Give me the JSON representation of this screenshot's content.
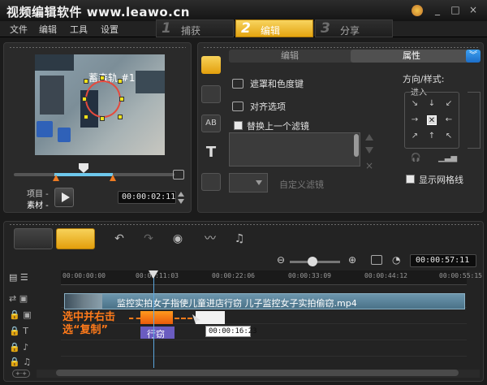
{
  "app": {
    "title": "视频编辑软件 www.leawo.cn"
  },
  "menu": {
    "items": [
      "文件",
      "编辑",
      "工具",
      "设置"
    ]
  },
  "steps": [
    {
      "num": "1",
      "label": "捕获"
    },
    {
      "num": "2",
      "label": "编辑"
    },
    {
      "num": "3",
      "label": "分享"
    }
  ],
  "player": {
    "overlay_text": "蓄森轨 #1",
    "project_label": "项目 -",
    "clip_label": "素材 -",
    "timecode": "00:00:02:11"
  },
  "props": {
    "tab_edit": "编辑",
    "tab_attr": "属性",
    "mask_label": "遮罩和色度键",
    "align_label": "对齐选项",
    "replace_filter_label": "替换上一个滤镜",
    "custom_filter_label": "自定义滤镜",
    "direction_label": "方向/样式:",
    "in_label": "进入",
    "grid_label": "显示网格线"
  },
  "timeline": {
    "duration": "00:00:57:11",
    "ruler": [
      "00:00:00:00",
      "00:00:11:03",
      "00:00:22:06",
      "00:00:33:09",
      "00:00:44:12",
      "00:00:55:15"
    ],
    "video_clip_name": "监控实拍女子指使儿童进店行窃 儿子监控女子实拍偷窃.mp4",
    "title_clip_text": "行窃",
    "annotation_line1": "选中并右击",
    "annotation_line2": "选“复制”",
    "tooltip_time": "00:00:16:23"
  }
}
